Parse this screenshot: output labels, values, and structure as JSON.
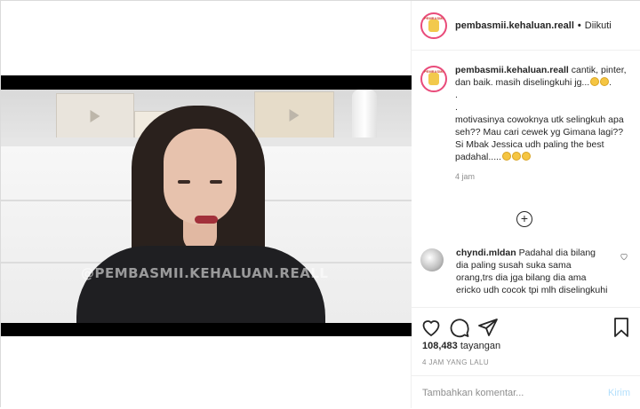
{
  "post": {
    "username": "pembasmii.kehaluan.reall",
    "separator": "•",
    "follow_status": "Diikuti",
    "avatar_text": "PEMBASMI"
  },
  "video": {
    "watermark": "@PEMBASMII.KEHALUAN.REALL"
  },
  "caption": {
    "username": "pembasmii.kehaluan.reall",
    "line1": "cantik, pinter, dan baik. masih diselingkuhi jg...",
    "dot1": ".",
    "dot2": ".",
    "line2": "motivasinya cowoknya utk selingkuh apa seh?? Mau cari cewek yg Gimana lagi?? Si Mbak Jessica udh paling the best padahal.....",
    "time": "4 jam"
  },
  "reply": {
    "username": "chyndi.mldan",
    "text": "Padahal dia bilang dia paling susah suka sama orang,trs dia jga bilang dia ama ericko udh cocok tpi mlh diselingkuhi"
  },
  "actions": {
    "views_count": "108,483",
    "views_label": "tayangan",
    "posted_ago": "4 JAM YANG LALU",
    "comment_placeholder": "Tambahkan komentar...",
    "post_label": "Kirim"
  },
  "icons": {
    "like": "heart-icon",
    "comment": "comment-icon",
    "share": "paper-plane-icon",
    "save": "bookmark-icon",
    "load_more": "plus-circle-icon",
    "reply_like": "heart-icon"
  },
  "colors": {
    "text": "#262626",
    "muted": "#8e8e8e",
    "post_button": "#b2dffc",
    "avatar_ring": "#e94b7a",
    "border": "#dbdbdb"
  }
}
